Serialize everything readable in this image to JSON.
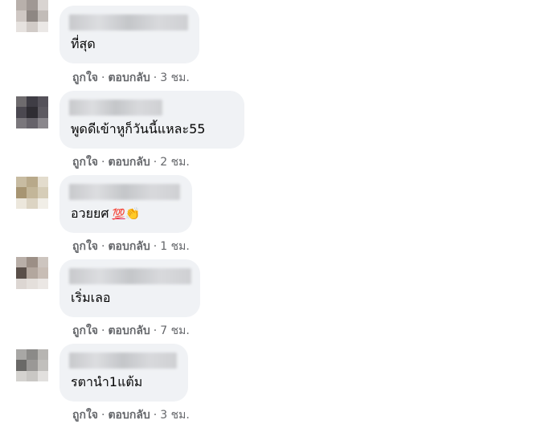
{
  "comments": [
    {
      "text": "ที่สุด",
      "like_label": "ถูกใจ",
      "reply_label": "ตอบกลับ",
      "separator": "·",
      "time": "3 ชม."
    },
    {
      "text": "พูดดีเข้าหูก็วันนี้แหละ55",
      "like_label": "ถูกใจ",
      "reply_label": "ตอบกลับ",
      "separator": "·",
      "time": "2 ชม."
    },
    {
      "text": "อวยยศ",
      "emoji_hundred": "💯",
      "emoji_clap": "👏",
      "like_label": "ถูกใจ",
      "reply_label": "ตอบกลับ",
      "separator": "·",
      "time": "1 ชม."
    },
    {
      "text": "เริ่มเลอ",
      "like_label": "ถูกใจ",
      "reply_label": "ตอบกลับ",
      "separator": "·",
      "time": "7 ชม."
    },
    {
      "text": "รตานำ1แต้ม",
      "like_label": "ถูกใจ",
      "reply_label": "ตอบกลับ",
      "separator": "·",
      "time": "3 ชม."
    }
  ],
  "colors": {
    "bubble_bg": "#f0f2f5",
    "text": "#050505",
    "secondary_text": "#65676b"
  }
}
